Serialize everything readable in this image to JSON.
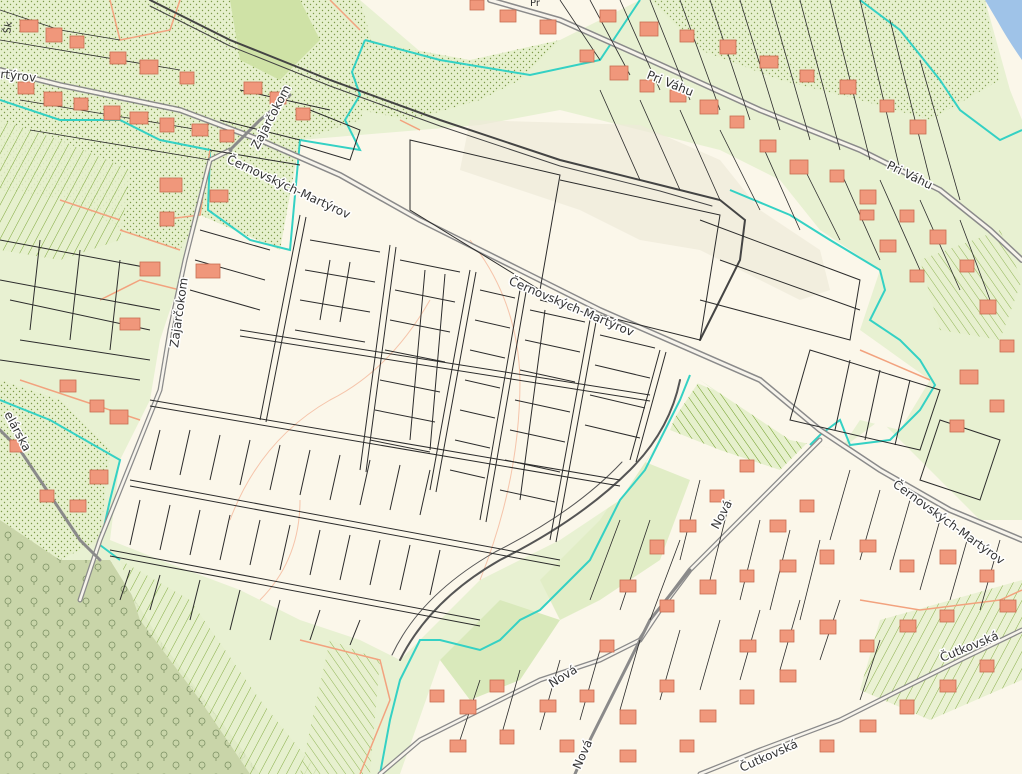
{
  "map": {
    "colors": {
      "background": "#fbf7ea",
      "garden": "#e6f0cd",
      "orchard": "#cfe2a6",
      "forest": "#c8d6a8",
      "building": "#f0977b",
      "building_outline": "#c76d52",
      "parcel_line": "#2c2c2c",
      "road": "#8a8a8a",
      "cadastral_boundary": "#34d1c4",
      "land_use_boundary": "#f2a27e",
      "river": "#9fc3e8",
      "strip_lines": "#6a9a1f"
    },
    "street_labels": [
      {
        "id": "pri-vahu-1",
        "text": "Pri Váhu"
      },
      {
        "id": "pri-vahu-2",
        "text": "Pri Váhu"
      },
      {
        "id": "martyrov-top",
        "text": "rtýrov"
      },
      {
        "id": "zajarockom-1",
        "text": "Zajarčokom"
      },
      {
        "id": "zajarockom-2",
        "text": "Zajarčokom"
      },
      {
        "id": "cernovskych-1",
        "text": "Černovských-Martýrov"
      },
      {
        "id": "cernovskych-2",
        "text": "Černovských-Martýrov"
      },
      {
        "id": "cernovskych-3",
        "text": "Černovských-Martýrov"
      },
      {
        "id": "nova-1",
        "text": "Nová"
      },
      {
        "id": "nova-2",
        "text": "Nová"
      },
      {
        "id": "nova-3",
        "text": "Nová"
      },
      {
        "id": "cutkovska-1",
        "text": "Čutkovská"
      },
      {
        "id": "cutkovska-2",
        "text": "Čutkovská"
      },
      {
        "id": "kelarska",
        "text": "elárska"
      }
    ],
    "edge_labels": [
      "Šk",
      "Pr"
    ]
  }
}
